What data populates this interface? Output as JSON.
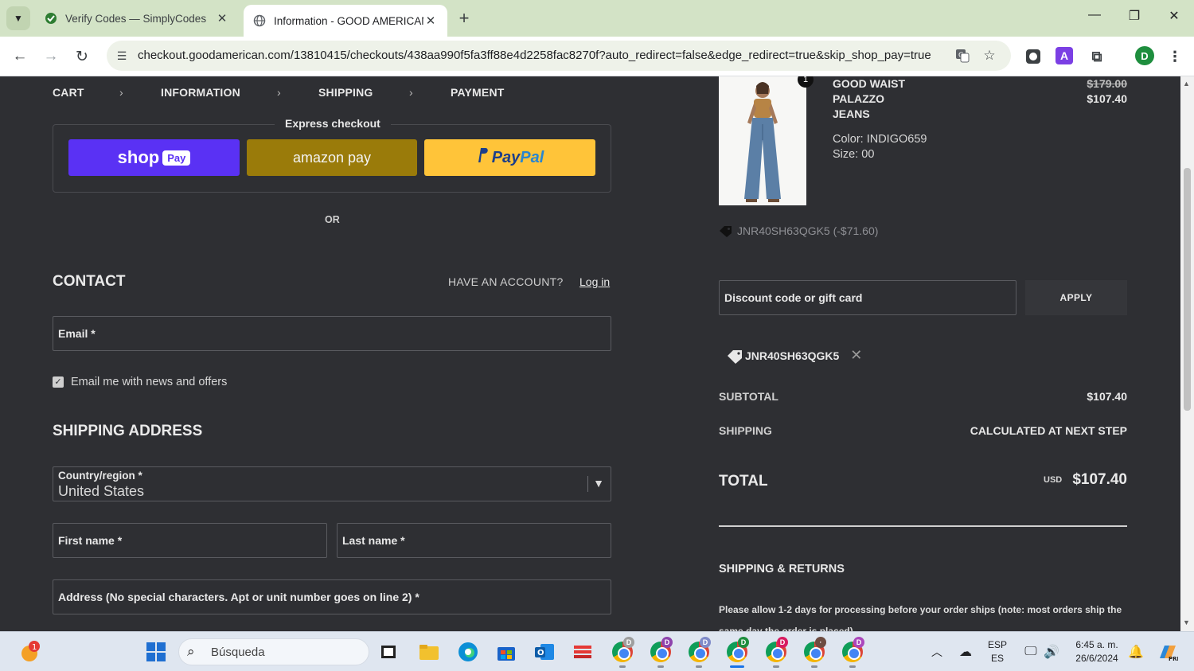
{
  "browser": {
    "tabs": [
      {
        "title": "Verify Codes — SimplyCodes",
        "active": false
      },
      {
        "title": "Information - GOOD AMERICAN",
        "active": true
      }
    ],
    "url": "checkout.goodamerican.com/13810415/checkouts/438aa990f5fa3ff88e4d2258fac8270f?auto_redirect=false&edge_redirect=true&skip_shop_pay=true",
    "profile_initial": "D"
  },
  "breadcrumb": [
    "CART",
    "INFORMATION",
    "SHIPPING",
    "PAYMENT"
  ],
  "express": {
    "title": "Express checkout",
    "shop_label": "shop",
    "shop_badge": "Pay",
    "amazon_label": "amazon pay",
    "paypal_label_1": "Pay",
    "paypal_label_2": "Pal",
    "or": "OR"
  },
  "contact": {
    "heading": "CONTACT",
    "have_account": "HAVE AN ACCOUNT?",
    "login": "Log in",
    "email_label": "Email *",
    "newsletter": "Email me with news and offers",
    "newsletter_checked": true
  },
  "shipping_address": {
    "heading": "SHIPPING ADDRESS",
    "country_label": "Country/region *",
    "country_value": "United States",
    "first_name": "First name *",
    "last_name": "Last name *",
    "address": "Address (No special characters. Apt or unit number goes on line 2) *"
  },
  "summary": {
    "quantity": "1",
    "product_name_1": "GOOD WAIST",
    "product_name_2": "PALAZZO",
    "product_name_3": "JEANS",
    "color": "Color: INDIGO659",
    "size": "Size: 00",
    "price_old": "$179.00",
    "price_new": "$107.40",
    "line_discount": "JNR40SH63QGK5 (-$71.60)",
    "discount_placeholder": "Discount code or gift card",
    "apply": "APPLY",
    "applied_code": "JNR40SH63QGK5",
    "subtotal_label": "SUBTOTAL",
    "subtotal_value": "$107.40",
    "shipping_label": "SHIPPING",
    "shipping_value": "CALCULATED AT NEXT STEP",
    "total_label": "TOTAL",
    "currency": "USD",
    "total_value": "$107.40",
    "shipping_returns_heading": "SHIPPING & RETURNS",
    "shipping_returns_text": "Please allow 1-2 days for processing before your order ships (note: most orders ship the same day the order is placed)."
  },
  "taskbar": {
    "search": "Búsqueda",
    "notification_count": "1",
    "lang_1": "ESP",
    "lang_2": "ES",
    "time": "6:45 a. m.",
    "date": "26/6/2024"
  }
}
